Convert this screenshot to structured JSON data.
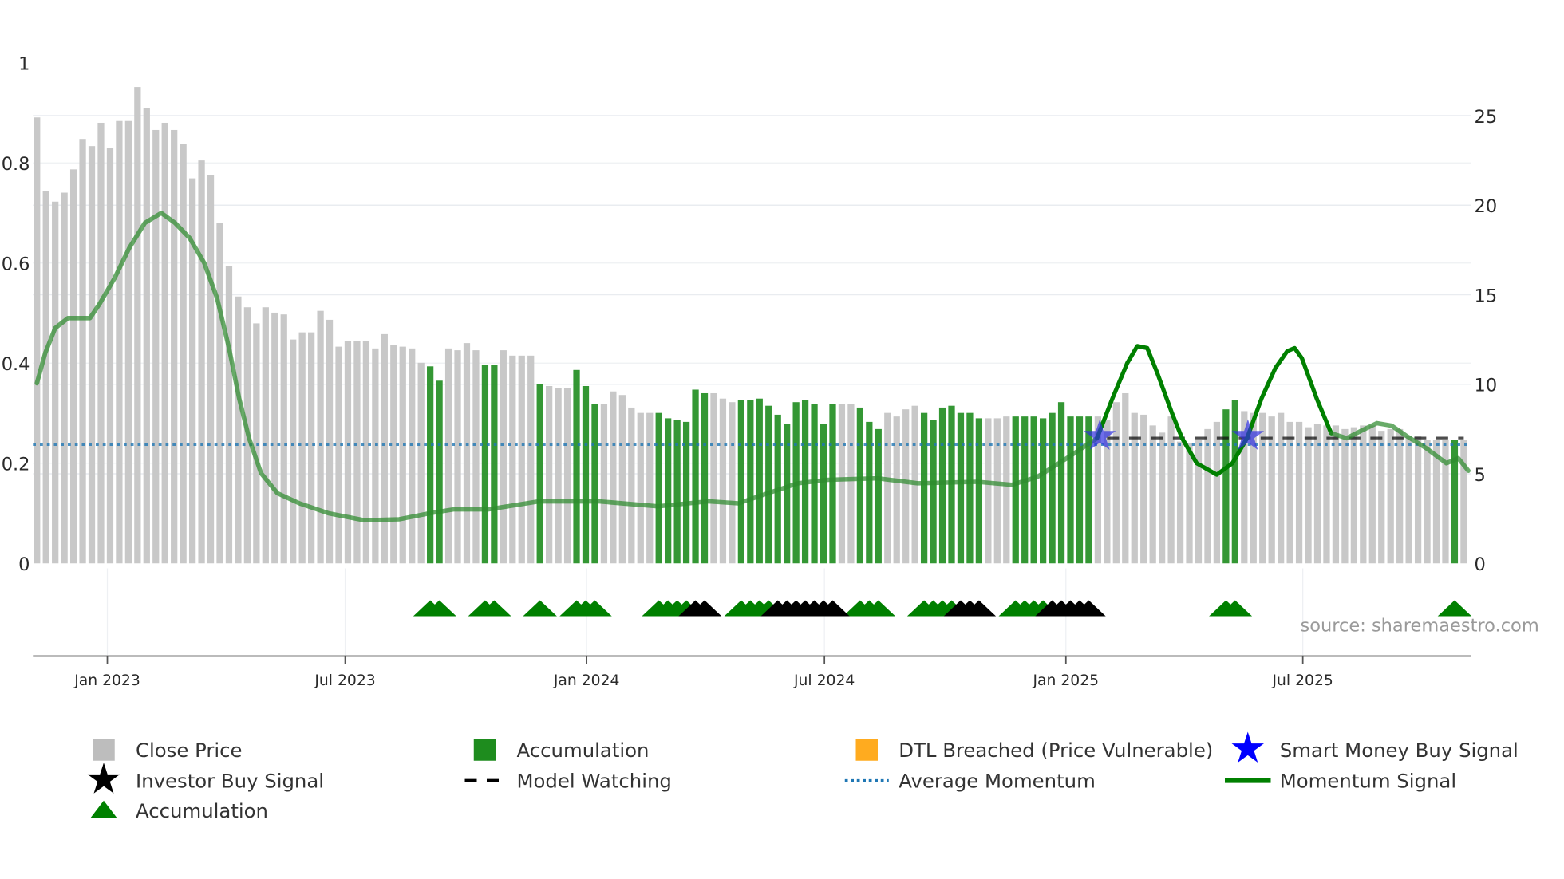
{
  "chart_data": {
    "type": "bar",
    "title": "",
    "x_unit": "week index",
    "left_axis": {
      "ticks": [
        "0",
        "0.2",
        "0.4",
        "0.6",
        "0.8",
        "1"
      ],
      "values": [
        0,
        0.2,
        0.4,
        0.6,
        0.8,
        1
      ],
      "range": [
        0,
        1
      ]
    },
    "right_axis": {
      "ticks": [
        "0",
        "5",
        "10",
        "15",
        "20",
        "25"
      ],
      "values": [
        0,
        5,
        10,
        15,
        20,
        25
      ],
      "range": [
        0,
        27.9
      ]
    },
    "x_ticks": [
      {
        "label": "Jan 2023",
        "index": 7.7
      },
      {
        "label": "Jul 2023",
        "index": 33.7
      },
      {
        "label": "Jan 2024",
        "index": 60.1
      },
      {
        "label": "Jul 2024",
        "index": 86.1
      },
      {
        "label": "Jan 2025",
        "index": 112.5
      },
      {
        "label": "Jul 2025",
        "index": 138.4
      }
    ],
    "close_price": [
      24.9,
      20.8,
      20.2,
      20.7,
      22.0,
      23.7,
      23.3,
      24.6,
      23.2,
      24.7,
      24.7,
      26.6,
      25.4,
      24.2,
      24.6,
      24.2,
      23.4,
      21.5,
      22.5,
      21.7,
      19.0,
      16.6,
      14.9,
      14.3,
      13.4,
      14.3,
      14.0,
      13.9,
      12.5,
      12.9,
      12.9,
      14.1,
      13.6,
      12.1,
      12.4,
      12.4,
      12.4,
      12.0,
      12.8,
      12.2,
      12.1,
      12.0,
      11.2,
      11.0,
      10.2,
      12.0,
      11.9,
      12.3,
      11.9,
      11.1,
      11.1,
      11.9,
      11.6,
      11.6,
      11.6,
      10.0,
      9.9,
      9.8,
      9.8,
      10.8,
      9.9,
      8.9,
      8.9,
      9.6,
      9.4,
      8.7,
      8.4,
      8.4,
      8.4,
      8.1,
      8.0,
      7.9,
      9.7,
      9.5,
      9.5,
      9.2,
      9.0,
      9.1,
      9.1,
      9.2,
      8.8,
      8.3,
      7.8,
      9.0,
      9.1,
      8.9,
      7.8,
      8.9,
      8.9,
      8.9,
      8.7,
      7.9,
      7.5,
      8.4,
      8.2,
      8.6,
      8.8,
      8.4,
      8.0,
      8.7,
      8.8,
      8.4,
      8.4,
      8.1,
      8.1,
      8.1,
      8.2,
      8.2,
      8.2,
      8.2,
      8.1,
      8.4,
      9.0,
      8.2,
      8.2,
      8.2,
      8.2,
      8.0,
      9.0,
      9.5,
      8.4,
      8.3,
      7.7,
      7.3,
      8.2,
      6.8,
      6.7,
      6.9,
      7.5,
      7.9,
      8.6,
      9.1,
      8.5,
      8.4,
      8.4,
      8.2,
      8.4,
      7.9,
      7.9,
      7.6,
      7.8,
      7.7,
      7.7,
      7.5,
      7.6,
      7.7,
      7.7,
      7.4,
      7.5,
      7.5,
      7.1,
      7.1,
      6.9,
      6.9,
      6.9,
      6.9,
      6.9
    ],
    "accumulation_bars": [
      43,
      44,
      49,
      50,
      55,
      59,
      60,
      61,
      68,
      69,
      70,
      71,
      72,
      73,
      77,
      78,
      79,
      80,
      81,
      82,
      83,
      84,
      85,
      86,
      87,
      90,
      91,
      92,
      97,
      98,
      99,
      100,
      101,
      102,
      103,
      107,
      108,
      109,
      110,
      111,
      112,
      113,
      114,
      115,
      130,
      131,
      155
    ],
    "momentum_signal": [
      [
        0,
        0.36
      ],
      [
        0.9,
        0.42
      ],
      [
        2,
        0.47
      ],
      [
        3.4,
        0.49
      ],
      [
        5.8,
        0.49
      ],
      [
        6.9,
        0.52
      ],
      [
        8.5,
        0.57
      ],
      [
        10.1,
        0.63
      ],
      [
        11.8,
        0.68
      ],
      [
        13.6,
        0.7
      ],
      [
        15.1,
        0.68
      ],
      [
        16.7,
        0.65
      ],
      [
        18.3,
        0.6
      ],
      [
        19.7,
        0.53
      ],
      [
        21,
        0.43
      ],
      [
        22.1,
        0.33
      ],
      [
        23.2,
        0.25
      ],
      [
        24.5,
        0.18
      ],
      [
        26.3,
        0.14
      ],
      [
        28.7,
        0.12
      ],
      [
        31.9,
        0.1
      ],
      [
        35.8,
        0.086
      ],
      [
        39.6,
        0.088
      ],
      [
        42.9,
        0.1
      ],
      [
        45.6,
        0.108
      ],
      [
        49.4,
        0.108
      ],
      [
        54.9,
        0.124
      ],
      [
        61.4,
        0.124
      ],
      [
        67.9,
        0.114
      ],
      [
        73.4,
        0.124
      ],
      [
        76.7,
        0.12
      ],
      [
        79.9,
        0.14
      ],
      [
        83.2,
        0.16
      ],
      [
        86.5,
        0.167
      ],
      [
        91.9,
        0.17
      ],
      [
        96.3,
        0.16
      ],
      [
        102.8,
        0.163
      ],
      [
        106.6,
        0.157
      ],
      [
        109.4,
        0.173
      ],
      [
        112.6,
        0.21
      ],
      [
        115.9,
        0.25
      ],
      [
        117.6,
        0.33
      ],
      [
        119.2,
        0.4
      ],
      [
        120.3,
        0.434
      ],
      [
        121.4,
        0.43
      ],
      [
        122.5,
        0.38
      ],
      [
        124.1,
        0.3
      ],
      [
        125.2,
        0.25
      ],
      [
        126.8,
        0.2
      ],
      [
        129,
        0.177
      ],
      [
        130.7,
        0.2
      ],
      [
        132.3,
        0.25
      ],
      [
        133.9,
        0.33
      ],
      [
        135.4,
        0.39
      ],
      [
        136.7,
        0.424
      ],
      [
        137.5,
        0.43
      ],
      [
        138.3,
        0.41
      ],
      [
        139.9,
        0.33
      ],
      [
        141.5,
        0.26
      ],
      [
        143.2,
        0.25
      ],
      [
        144.8,
        0.265
      ],
      [
        146.5,
        0.28
      ],
      [
        148.1,
        0.275
      ],
      [
        149.7,
        0.255
      ],
      [
        151.9,
        0.23
      ],
      [
        154.1,
        0.2
      ],
      [
        155.4,
        0.21
      ],
      [
        156.5,
        0.185
      ]
    ],
    "momentum_strong_range": [
      115.9,
      141.5
    ],
    "average_momentum": 0.237,
    "model_watching": {
      "level": 7.0,
      "start_index": 117,
      "end_index": 156
    },
    "smart_money_buy_signals": [
      {
        "index": 116.2,
        "price": 7.1
      },
      {
        "index": 132.4,
        "price": 7.1
      }
    ],
    "accumulation_triangles": [
      43,
      44,
      49,
      50,
      55,
      59,
      60,
      61,
      68,
      69,
      70,
      71,
      77,
      78,
      79,
      80,
      90,
      91,
      92,
      97,
      98,
      99,
      100,
      107,
      108,
      109,
      110,
      130,
      131,
      155
    ],
    "investor_triangles": [
      72,
      73,
      81,
      82,
      83,
      84,
      85,
      86,
      87,
      101,
      102,
      103,
      111,
      112,
      113,
      114,
      115
    ],
    "source": "source: sharemaestro.com",
    "legend": [
      {
        "label": "Close Price",
        "symbol": "square",
        "color": "#bdbdbd"
      },
      {
        "label": "Accumulation",
        "symbol": "square",
        "color": "#1e8c1e"
      },
      {
        "label": "DTL Breached (Price Vulnerable)",
        "symbol": "square",
        "color": "#ffab1f"
      },
      {
        "label": "Smart Money Buy Signal",
        "symbol": "star",
        "color": "#0000ff"
      },
      {
        "label": "Investor Buy Signal",
        "symbol": "star",
        "color": "#000000"
      },
      {
        "label": "Model Watching",
        "symbol": "dash",
        "color": "#000000"
      },
      {
        "label": "Average Momentum",
        "symbol": "dot",
        "color": "#1f77b4"
      },
      {
        "label": "Momentum Signal",
        "symbol": "line",
        "color": "#008000"
      },
      {
        "label": "Accumulation",
        "symbol": "triangle",
        "color": "#008000"
      }
    ]
  }
}
